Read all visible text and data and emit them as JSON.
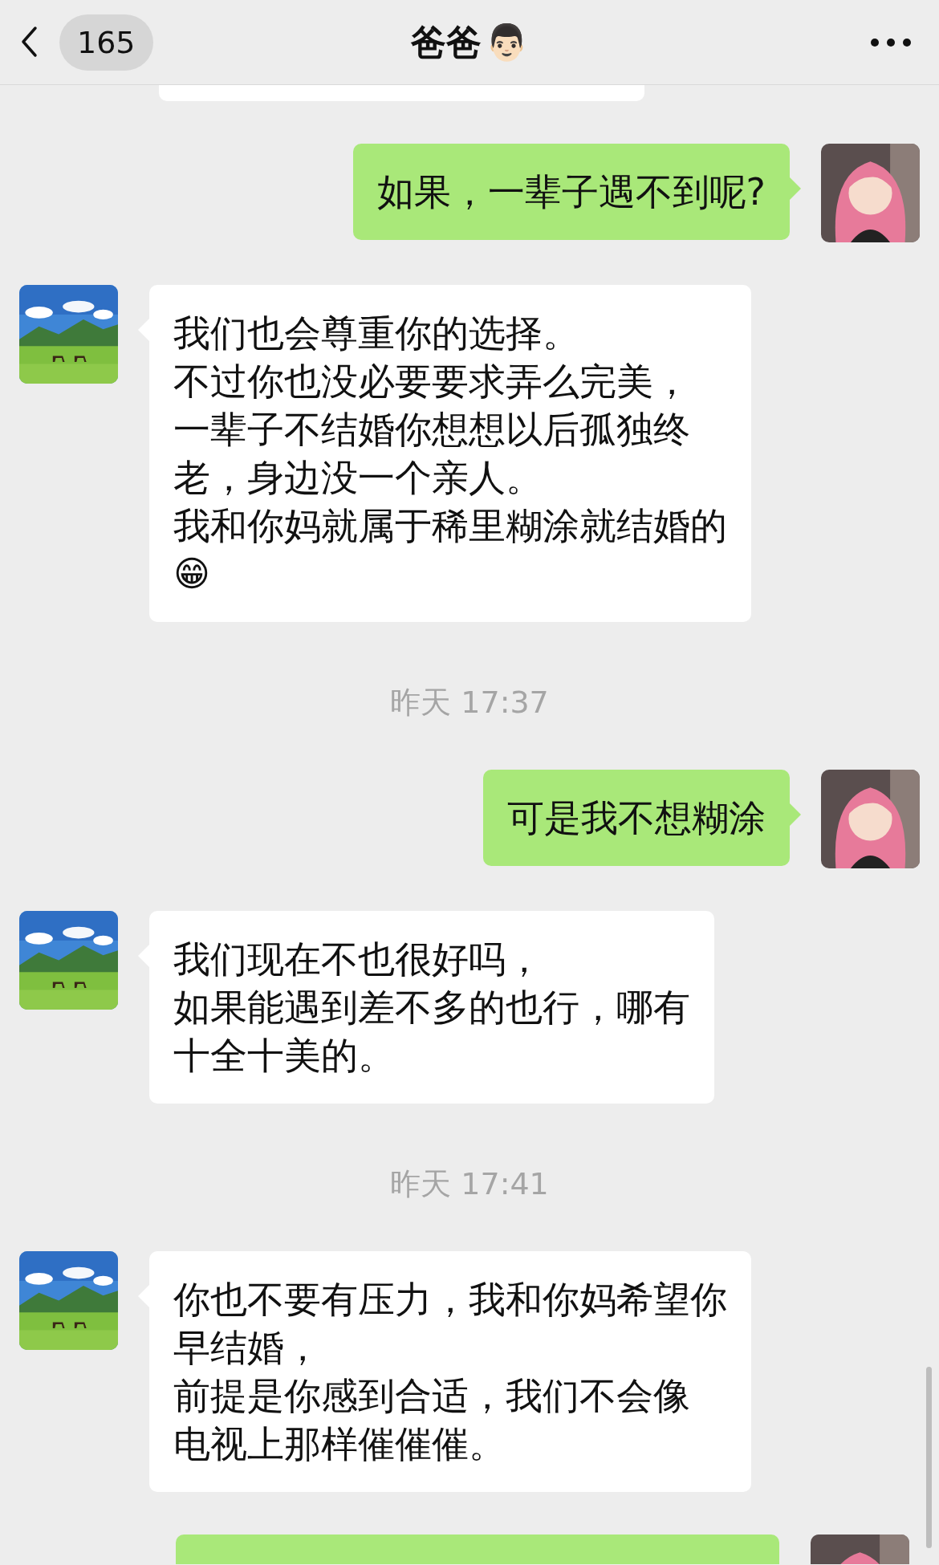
{
  "header": {
    "unread_count": "165",
    "title": "爸爸",
    "title_emoji": "👨🏻"
  },
  "messages": [
    {
      "kind": "partial"
    },
    {
      "kind": "outgoing",
      "lines": [
        "如果，一辈子遇不到呢?"
      ]
    },
    {
      "kind": "incoming",
      "lines": [
        "我们也会尊重你的选择。",
        "不过你也没必要要求弄么完美，",
        "一辈子不结婚你想想以后孤独终",
        "老，身边没一个亲人。",
        "我和你妈就属于稀里糊涂就结婚的"
      ],
      "trailing_emoji": "😁"
    },
    {
      "kind": "time",
      "text": "昨天 17:37"
    },
    {
      "kind": "outgoing",
      "lines": [
        "可是我不想糊涂"
      ]
    },
    {
      "kind": "incoming",
      "lines": [
        "我们现在不也很好吗，",
        "如果能遇到差不多的也行，哪有",
        "十全十美的。"
      ]
    },
    {
      "kind": "time",
      "text": "昨天 17:41"
    },
    {
      "kind": "incoming",
      "lines": [
        "你也不要有压力，我和你妈希望你",
        "早结婚，",
        "前提是你感到合适，我们不会像",
        "电视上那样催催催。"
      ]
    },
    {
      "kind": "outgoing_cut"
    }
  ]
}
